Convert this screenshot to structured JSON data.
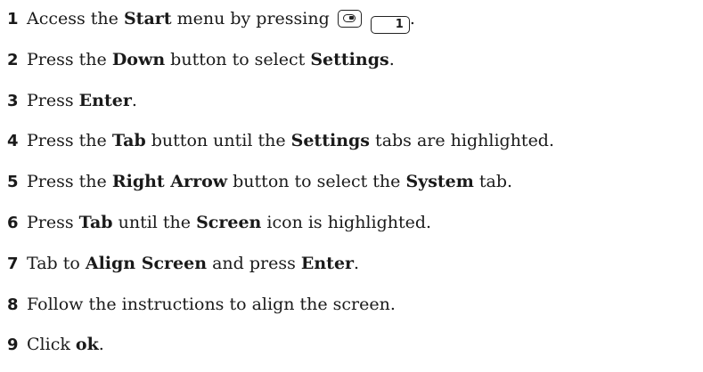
{
  "steps": [
    {
      "number": "1",
      "parts": [
        {
          "t": "Access the "
        },
        {
          "t": "Start",
          "b": true
        },
        {
          "t": " menu by pressing "
        },
        {
          "key": "function-key"
        },
        {
          "key": "one-key",
          "label": "1"
        },
        {
          "t": "."
        }
      ]
    },
    {
      "number": "2",
      "parts": [
        {
          "t": "Press the "
        },
        {
          "t": "Down",
          "b": true
        },
        {
          "t": " button to select "
        },
        {
          "t": "Settings",
          "b": true
        },
        {
          "t": "."
        }
      ]
    },
    {
      "number": "3",
      "parts": [
        {
          "t": "Press "
        },
        {
          "t": "Enter",
          "b": true
        },
        {
          "t": "."
        }
      ]
    },
    {
      "number": "4",
      "parts": [
        {
          "t": "Press the "
        },
        {
          "t": "Tab",
          "b": true
        },
        {
          "t": " button until the "
        },
        {
          "t": "Settings",
          "b": true
        },
        {
          "t": " tabs are highlighted."
        }
      ]
    },
    {
      "number": "5",
      "parts": [
        {
          "t": "Press the "
        },
        {
          "t": "Right Arrow",
          "b": true
        },
        {
          "t": " button to select the "
        },
        {
          "t": "System",
          "b": true
        },
        {
          "t": " tab."
        }
      ]
    },
    {
      "number": "6",
      "parts": [
        {
          "t": "Press "
        },
        {
          "t": "Tab",
          "b": true
        },
        {
          "t": " until the "
        },
        {
          "t": "Screen",
          "b": true
        },
        {
          "t": " icon is highlighted."
        }
      ]
    },
    {
      "number": "7",
      "parts": [
        {
          "t": "Tab to "
        },
        {
          "t": "Align Screen",
          "b": true
        },
        {
          "t": " and press "
        },
        {
          "t": "Enter",
          "b": true
        },
        {
          "t": "."
        }
      ]
    },
    {
      "number": "8",
      "parts": [
        {
          "t": "Follow the instructions to align the screen."
        }
      ]
    },
    {
      "number": "9",
      "parts": [
        {
          "t": "Click "
        },
        {
          "t": "ok",
          "b": true
        },
        {
          "t": "."
        }
      ]
    }
  ]
}
